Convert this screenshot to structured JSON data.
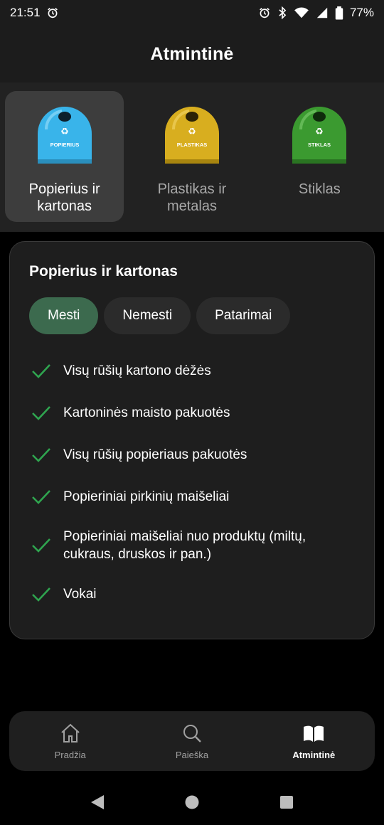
{
  "status_bar": {
    "time": "21:51",
    "battery": "77%",
    "icons": [
      "alarm-icon",
      "bluetooth-icon",
      "wifi-icon",
      "signal-icon",
      "battery-icon"
    ]
  },
  "header": {
    "title": "Atmintinė"
  },
  "categories": [
    {
      "label": "Popierius ir kartonas",
      "bin_label": "POPIERIUS",
      "color": "#39b4ea",
      "selected": true
    },
    {
      "label": "Plastikas ir metalas",
      "bin_label": "PLASTIKAS",
      "color": "#d8ae1f",
      "selected": false
    },
    {
      "label": "Stiklas",
      "bin_label": "STIKLAS",
      "color": "#3b9a30",
      "selected": false
    }
  ],
  "card": {
    "title": "Popierius ir kartonas",
    "tabs": [
      {
        "label": "Mesti",
        "active": true
      },
      {
        "label": "Nemesti",
        "active": false
      },
      {
        "label": "Patarimai",
        "active": false
      }
    ],
    "items": [
      "Visų rūšių kartono dėžės",
      "Kartoninės maisto pakuotės",
      "Visų rūšių popieriaus pakuotės",
      "Popieriniai pirkinių maišeliai",
      "Popieriniai maišeliai nuo produktų (miltų, cukraus, druskos ir pan.)",
      "Vokai"
    ]
  },
  "bottom_nav": [
    {
      "label": "Pradžia",
      "icon": "home-icon",
      "active": false
    },
    {
      "label": "Paieška",
      "icon": "search-icon",
      "active": false
    },
    {
      "label": "Atmintinė",
      "icon": "book-icon",
      "active": true
    }
  ],
  "colors": {
    "accent_green": "#3c6a4e",
    "check_green": "#2fa44f",
    "background": "#000000",
    "card_bg": "#1e1e1e"
  }
}
